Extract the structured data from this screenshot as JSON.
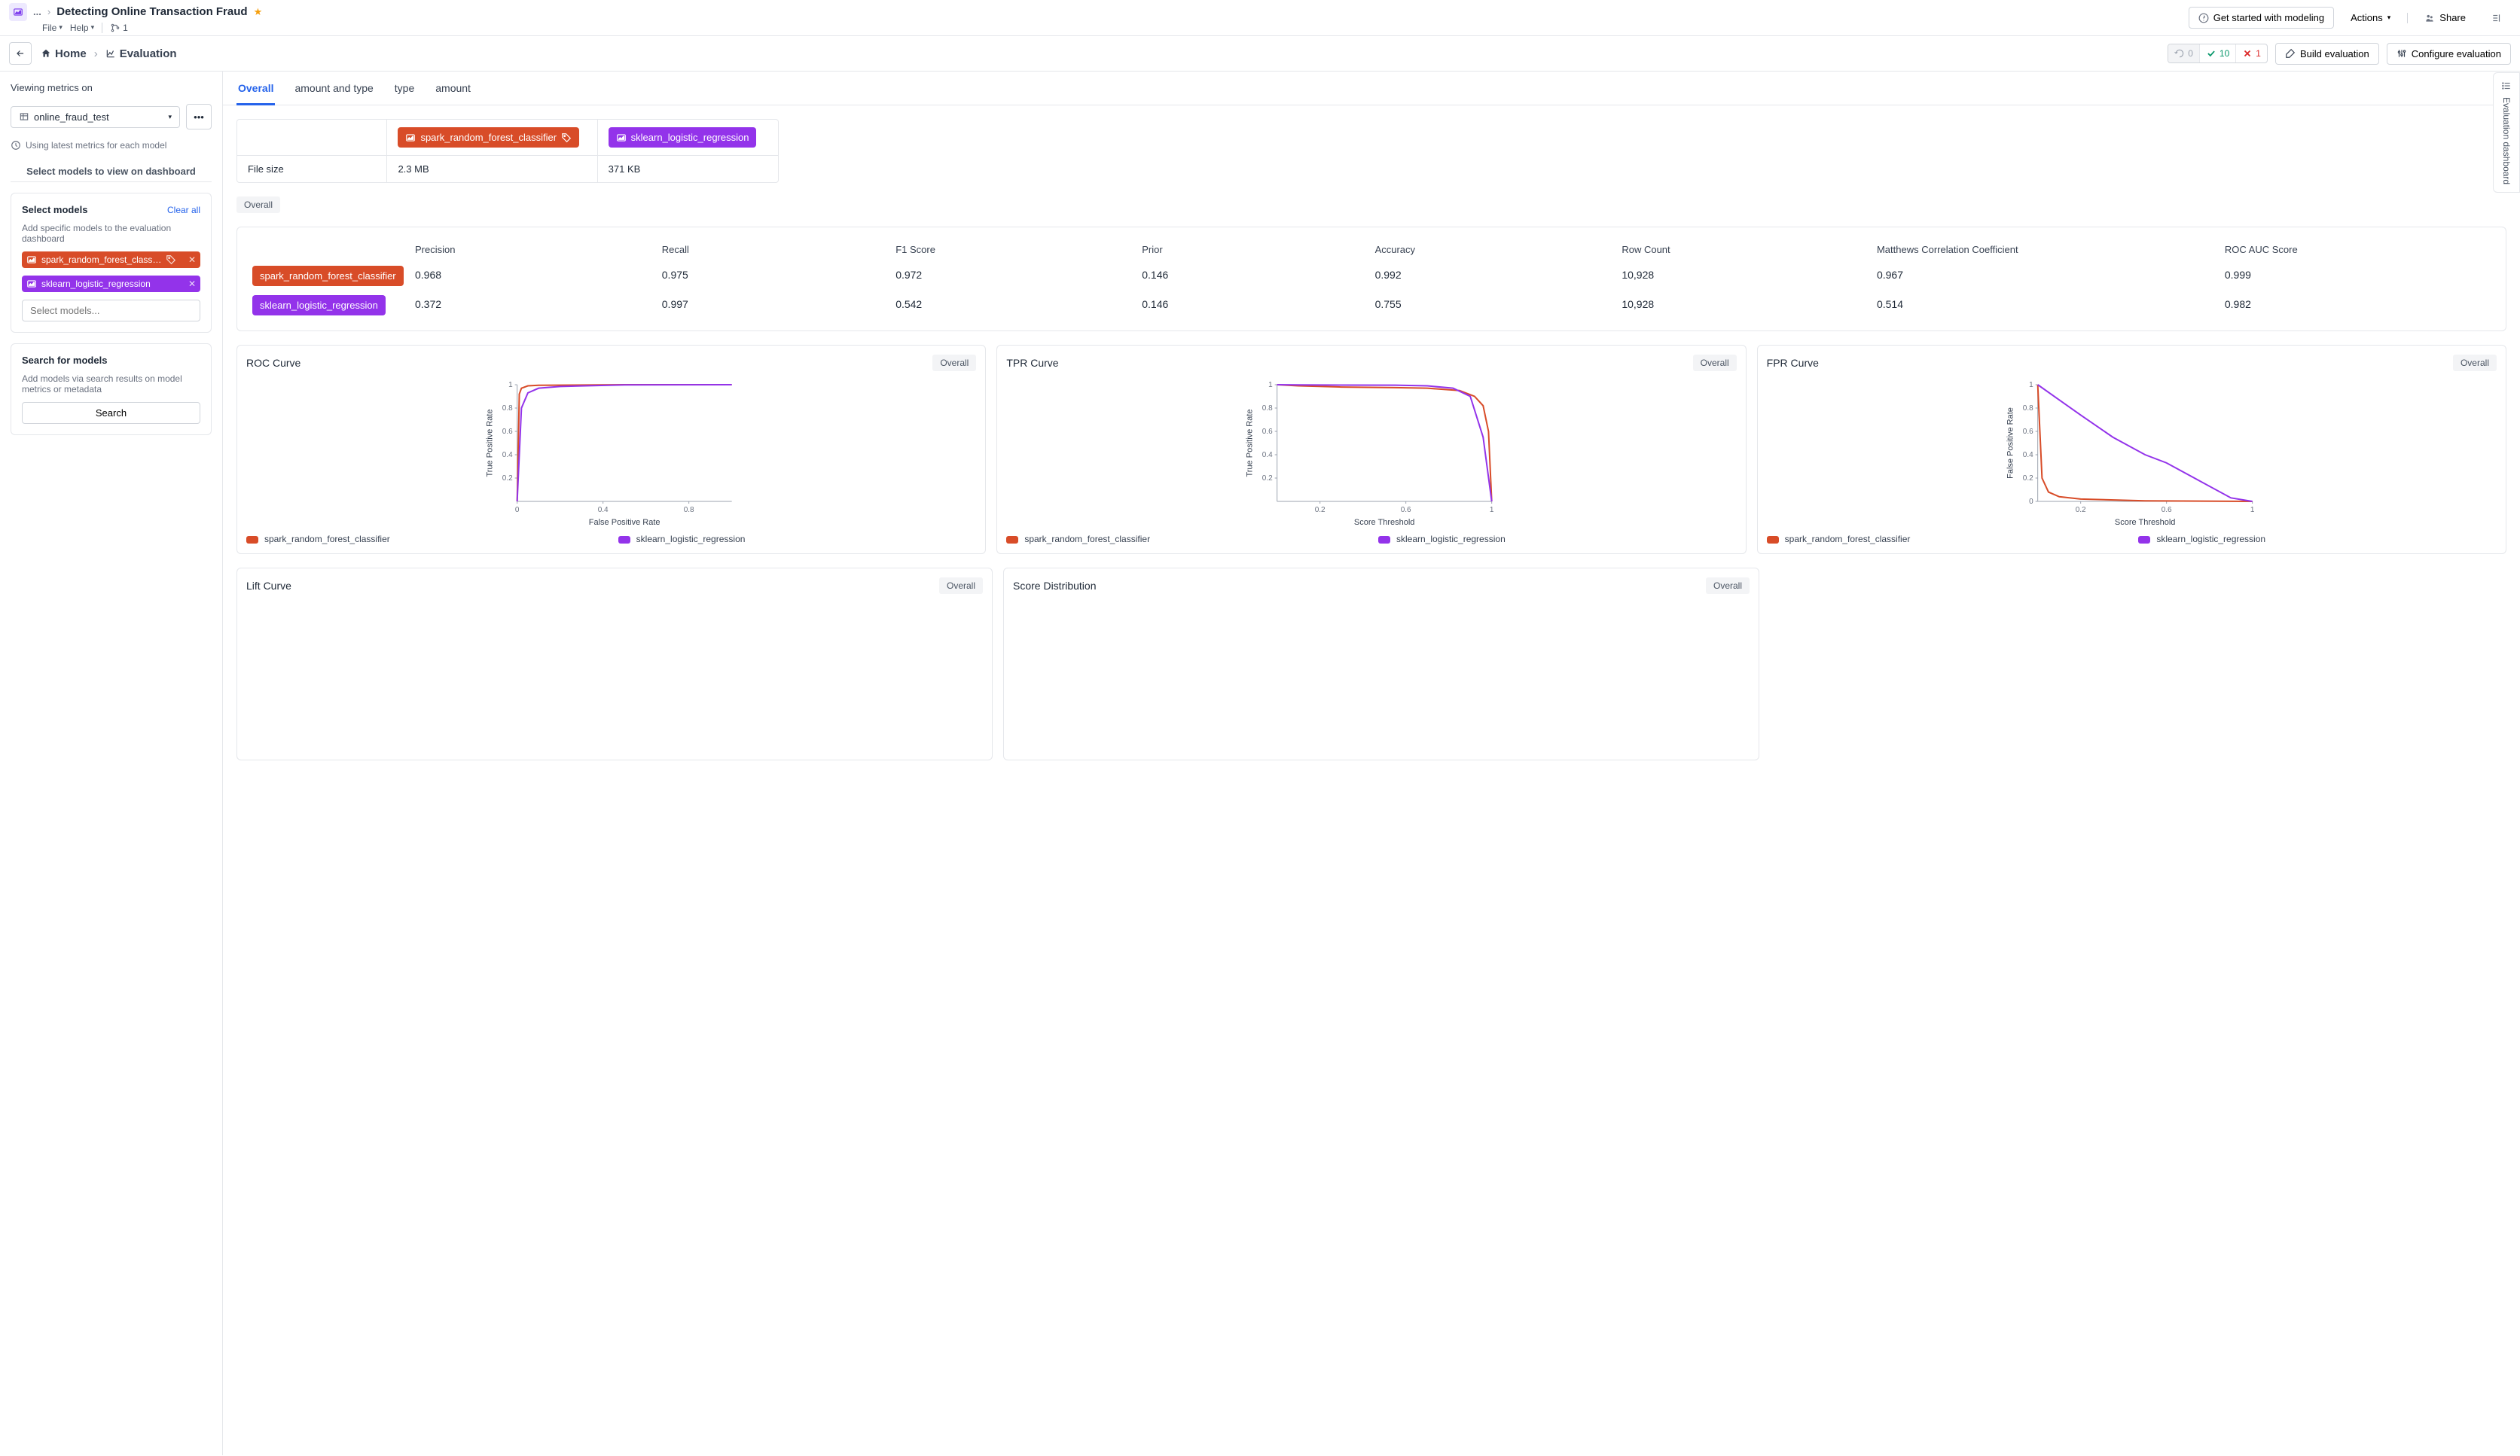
{
  "header": {
    "crumb_dots": "...",
    "title": "Detecting Online Transaction Fraud",
    "menu": {
      "file": "File",
      "help": "Help",
      "branch_count": "1"
    },
    "get_started": "Get started with modeling",
    "actions": "Actions",
    "share": "Share"
  },
  "toolbar": {
    "home": "Home",
    "evaluation": "Evaluation",
    "status": {
      "pending": "0",
      "passed": "10",
      "failed": "1"
    },
    "build": "Build evaluation",
    "configure": "Configure evaluation"
  },
  "sidebar": {
    "viewing_label": "Viewing metrics on",
    "dataset": "online_fraud_test",
    "hint": "Using latest metrics for each model",
    "select_heading": "Select models to view on dashboard",
    "select_panel": {
      "title": "Select models",
      "clear": "Clear all",
      "desc": "Add specific models to the evaluation dashboard",
      "chip1": "spark_random_forest_class…",
      "chip2": "sklearn_logistic_regression",
      "placeholder": "Select models..."
    },
    "search_panel": {
      "title": "Search for models",
      "desc": "Add models via search results on model metrics or metadata",
      "button": "Search"
    }
  },
  "tabs": [
    "Overall",
    "amount and type",
    "type",
    "amount"
  ],
  "models": {
    "m1": {
      "name": "spark_random_forest_classifier",
      "filesize": "2.3 MB"
    },
    "m2": {
      "name": "sklearn_logistic_regression",
      "filesize": "371 KB"
    }
  },
  "info_label": "File size",
  "overall_tag": "Overall",
  "metrics": {
    "headers": [
      "Precision",
      "Recall",
      "F1 Score",
      "Prior",
      "Accuracy",
      "Row Count",
      "Matthews Correlation Coefficient",
      "ROC AUC Score"
    ],
    "rows": [
      {
        "model": "spark_random_forest_classifier",
        "color": "red",
        "values": [
          "0.968",
          "0.975",
          "0.972",
          "0.146",
          "0.992",
          "10,928",
          "0.967",
          "0.999"
        ]
      },
      {
        "model": "sklearn_logistic_regression",
        "color": "purple",
        "values": [
          "0.372",
          "0.997",
          "0.542",
          "0.146",
          "0.755",
          "10,928",
          "0.514",
          "0.982"
        ]
      }
    ]
  },
  "charts": {
    "roc": {
      "title": "ROC Curve",
      "tag": "Overall",
      "xlabel": "False Positive Rate",
      "ylabel": "True Positive Rate"
    },
    "tpr": {
      "title": "TPR Curve",
      "tag": "Overall",
      "xlabel": "Score Threshold",
      "ylabel": "True Positive Rate"
    },
    "fpr": {
      "title": "FPR Curve",
      "tag": "Overall",
      "xlabel": "Score Threshold",
      "ylabel": "False Positive Rate"
    },
    "lift": {
      "title": "Lift Curve",
      "tag": "Overall"
    },
    "score": {
      "title": "Score Distribution",
      "tag": "Overall"
    },
    "legend": {
      "m1": "spark_random_forest_classifier",
      "m2": "sklearn_logistic_regression"
    }
  },
  "chart_data": [
    {
      "type": "line",
      "title": "ROC Curve",
      "xlabel": "False Positive Rate",
      "ylabel": "True Positive Rate",
      "xlim": [
        0,
        1
      ],
      "ylim": [
        0,
        1
      ],
      "x_ticks": [
        0,
        0.4,
        0.8
      ],
      "y_ticks": [
        0.2,
        0.4,
        0.6,
        0.8,
        1
      ],
      "series": [
        {
          "name": "spark_random_forest_classifier",
          "color": "#d84c28",
          "x": [
            0,
            0.01,
            0.02,
            0.05,
            0.1,
            0.5,
            1
          ],
          "y": [
            0,
            0.92,
            0.97,
            0.99,
            0.995,
            1,
            1
          ]
        },
        {
          "name": "sklearn_logistic_regression",
          "color": "#9333ea",
          "x": [
            0,
            0.02,
            0.05,
            0.1,
            0.2,
            0.5,
            1
          ],
          "y": [
            0,
            0.8,
            0.93,
            0.97,
            0.985,
            0.998,
            1
          ]
        }
      ]
    },
    {
      "type": "line",
      "title": "TPR Curve",
      "xlabel": "Score Threshold",
      "ylabel": "True Positive Rate",
      "xlim": [
        0,
        1
      ],
      "ylim": [
        0,
        1
      ],
      "x_ticks": [
        0.2,
        0.6,
        1
      ],
      "y_ticks": [
        0.2,
        0.4,
        0.6,
        0.8,
        1
      ],
      "series": [
        {
          "name": "spark_random_forest_classifier",
          "color": "#d84c28",
          "x": [
            0,
            0.1,
            0.3,
            0.55,
            0.7,
            0.85,
            0.92,
            0.96,
            0.985,
            1
          ],
          "y": [
            1,
            0.99,
            0.98,
            0.975,
            0.97,
            0.95,
            0.9,
            0.82,
            0.6,
            0
          ]
        },
        {
          "name": "sklearn_logistic_regression",
          "color": "#9333ea",
          "x": [
            0,
            0.1,
            0.3,
            0.55,
            0.7,
            0.82,
            0.9,
            0.96,
            1
          ],
          "y": [
            1,
            0.998,
            0.997,
            0.996,
            0.99,
            0.97,
            0.9,
            0.55,
            0
          ]
        }
      ]
    },
    {
      "type": "line",
      "title": "FPR Curve",
      "xlabel": "Score Threshold",
      "ylabel": "False Positive Rate",
      "xlim": [
        0,
        1
      ],
      "ylim": [
        0,
        1
      ],
      "x_ticks": [
        0.2,
        0.6,
        1
      ],
      "y_ticks": [
        0,
        0.2,
        0.4,
        0.6,
        0.8,
        1
      ],
      "series": [
        {
          "name": "spark_random_forest_classifier",
          "color": "#d84c28",
          "x": [
            0,
            0.02,
            0.05,
            0.1,
            0.2,
            0.5,
            1
          ],
          "y": [
            1,
            0.2,
            0.08,
            0.04,
            0.02,
            0.005,
            0
          ]
        },
        {
          "name": "sklearn_logistic_regression",
          "color": "#9333ea",
          "x": [
            0,
            0.1,
            0.2,
            0.35,
            0.5,
            0.6,
            0.75,
            0.9,
            1
          ],
          "y": [
            1,
            0.87,
            0.74,
            0.55,
            0.4,
            0.33,
            0.18,
            0.03,
            0
          ]
        }
      ]
    }
  ],
  "right_rail": "Evaluation dashboard"
}
